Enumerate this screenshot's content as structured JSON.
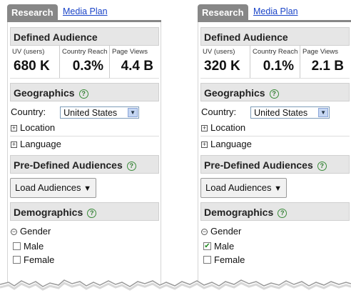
{
  "panels": [
    {
      "tabs": {
        "active": "Research",
        "link": "Media Plan"
      },
      "defined_audience": {
        "title": "Defined Audience",
        "stats": [
          {
            "label": "UV (users)",
            "value": "680 K"
          },
          {
            "label": "Country Reach",
            "value": "0.3%"
          },
          {
            "label": "Page Views",
            "value": "4.4 B"
          }
        ]
      },
      "geographics": {
        "title": "Geographics",
        "help": "?",
        "country_label": "Country:",
        "country_value": "United States",
        "location": "Location",
        "language": "Language"
      },
      "predefined": {
        "title": "Pre-Defined Audiences",
        "help": "?",
        "button": "Load Audiences"
      },
      "demographics": {
        "title": "Demographics",
        "help": "?",
        "gender": "Gender",
        "male": "Male",
        "female": "Female",
        "male_checked": false,
        "female_checked": false
      }
    },
    {
      "tabs": {
        "active": "Research",
        "link": "Media Plan"
      },
      "defined_audience": {
        "title": "Defined Audience",
        "stats": [
          {
            "label": "UV (users)",
            "value": "320 K"
          },
          {
            "label": "Country Reach",
            "value": "0.1%"
          },
          {
            "label": "Page Views",
            "value": "2.1 B"
          }
        ]
      },
      "geographics": {
        "title": "Geographics",
        "help": "?",
        "country_label": "Country:",
        "country_value": "United States",
        "location": "Location",
        "language": "Language"
      },
      "predefined": {
        "title": "Pre-Defined Audiences",
        "help": "?",
        "button": "Load Audiences"
      },
      "demographics": {
        "title": "Demographics",
        "help": "?",
        "gender": "Gender",
        "male": "Male",
        "female": "Female",
        "male_checked": true,
        "female_checked": false
      }
    }
  ]
}
